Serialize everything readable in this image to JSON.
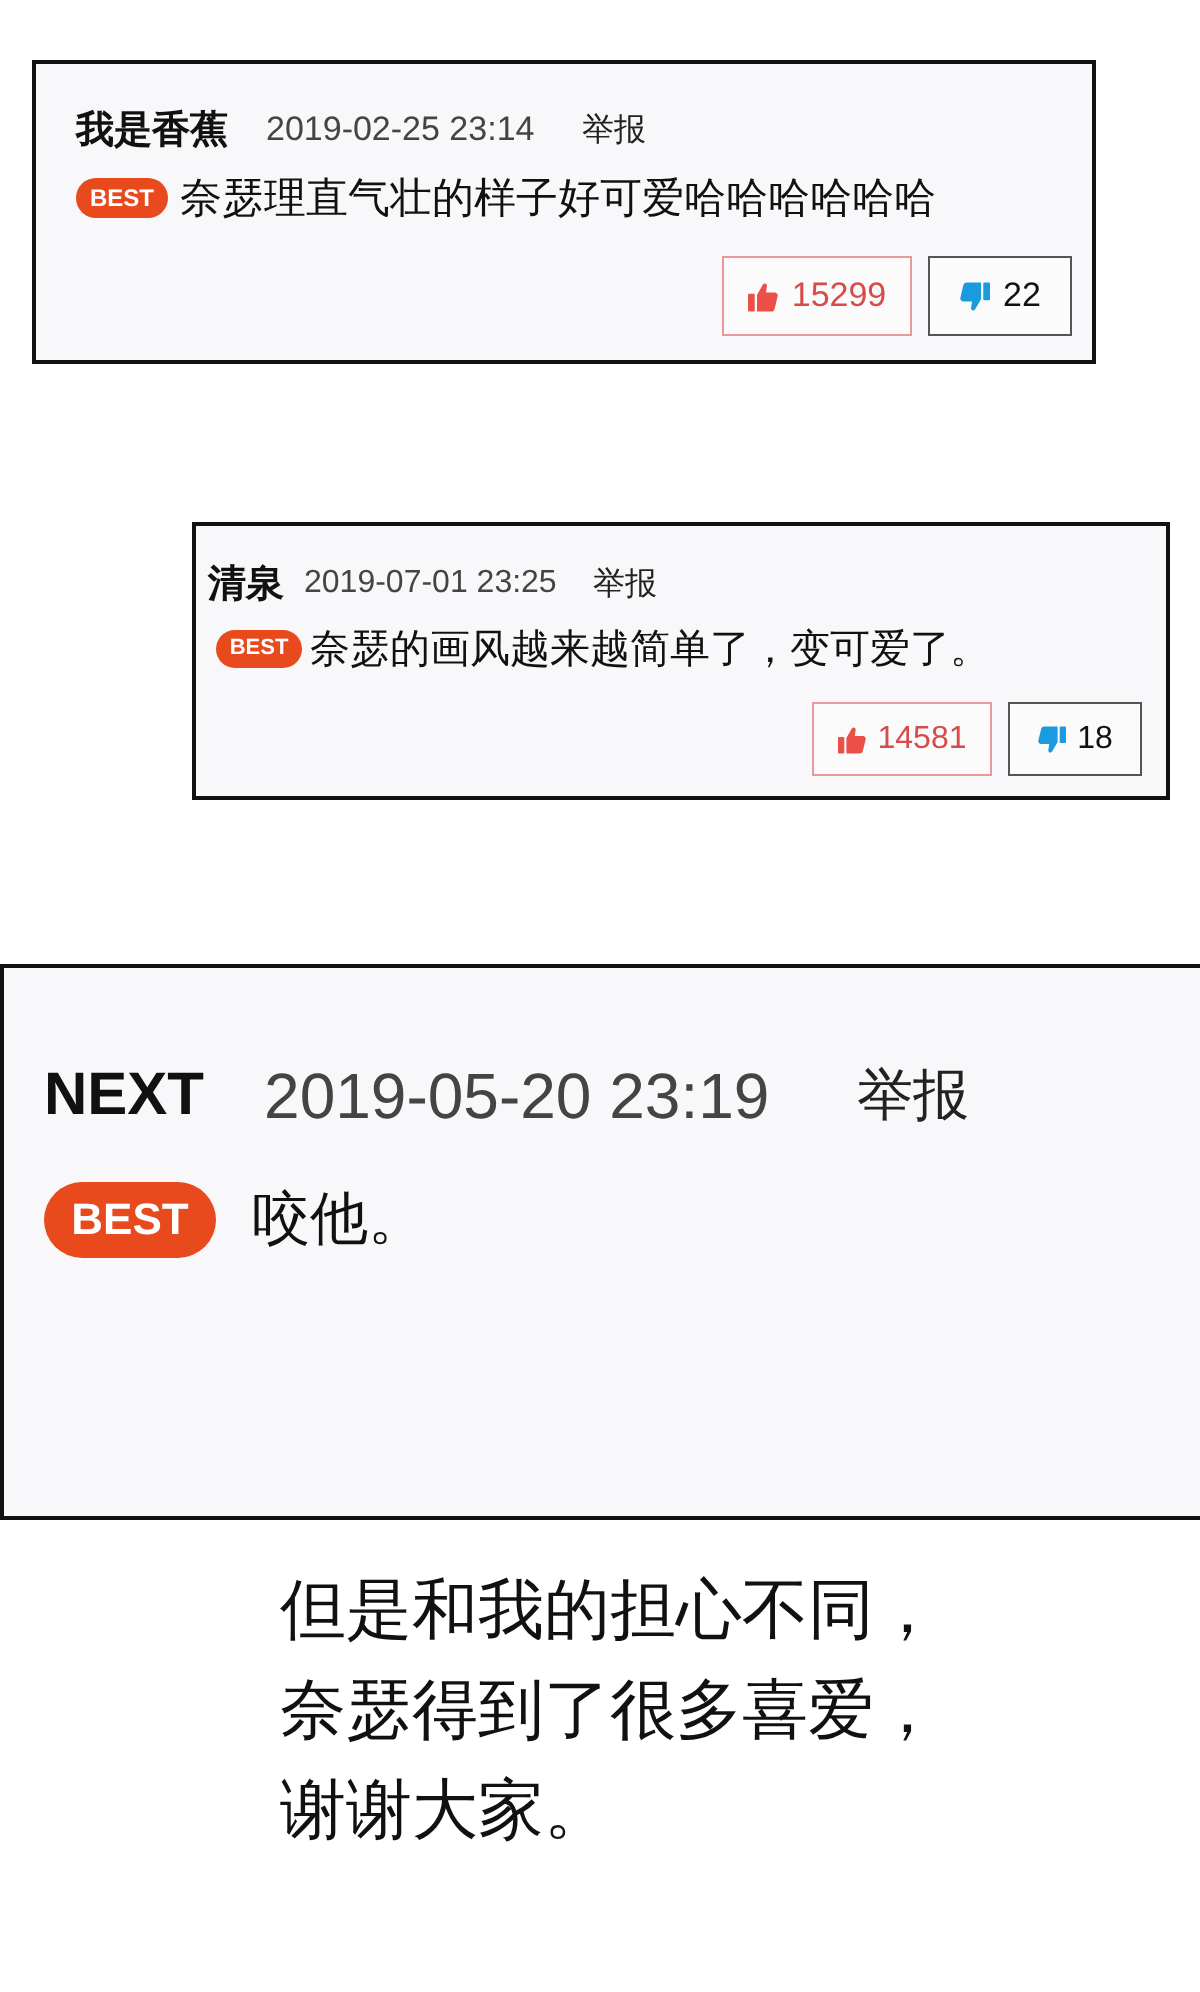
{
  "comments": [
    {
      "user": "我是香蕉",
      "time": "2019-02-25 23:14",
      "report": "举报",
      "badge": "BEST",
      "text": "奈瑟理直气壮的样子好可爱哈哈哈哈哈哈",
      "likes": "15299",
      "dislikes": "22"
    },
    {
      "user": "清泉",
      "time": "2019-07-01 23:25",
      "report": "举报",
      "badge": "BEST",
      "text": "奈瑟的画风越来越简单了，变可爱了。",
      "likes": "14581",
      "dislikes": "18"
    },
    {
      "user": "NEXT",
      "time": "2019-05-20 23:19",
      "report": "举报",
      "badge": "BEST",
      "text": "咬他。"
    }
  ],
  "caption": [
    "但是和我的担心不同，",
    "奈瑟得到了很多喜爱，",
    "谢谢大家。"
  ]
}
